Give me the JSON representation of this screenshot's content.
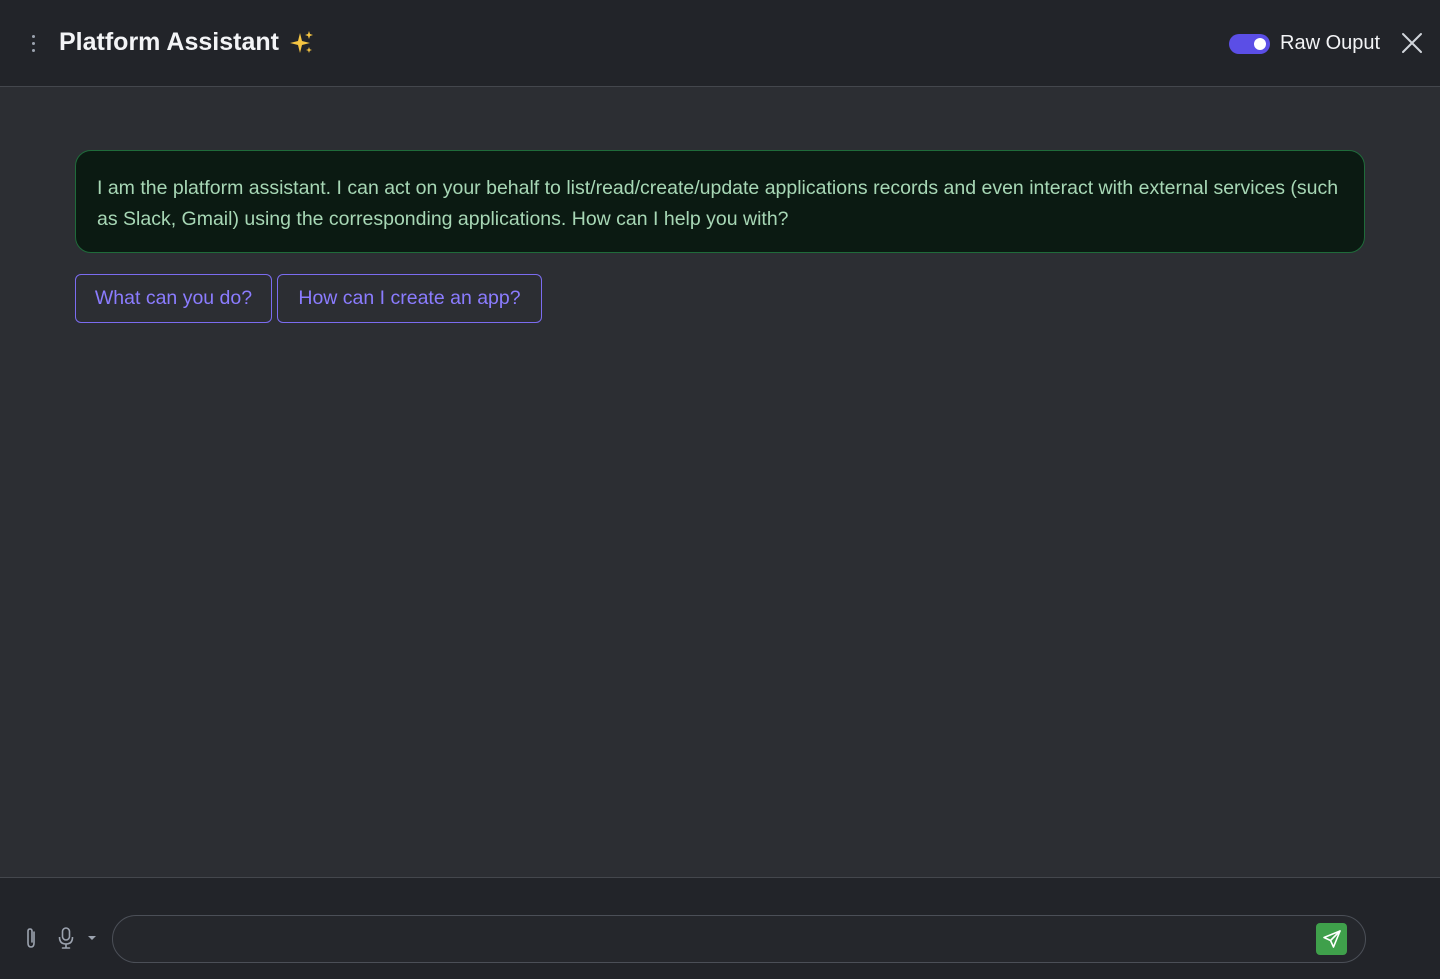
{
  "header": {
    "title": "Platform Assistant",
    "toggle_label": "Raw Ouput",
    "toggle_on": true
  },
  "message": {
    "text": "I am the platform assistant. I can act on your behalf to list/read/create/update applications records and even interact with external services (such as Slack, Gmail) using the corresponding applications. How can I help you with?"
  },
  "suggestions": [
    {
      "label": "What can you do?"
    },
    {
      "label": "How can I create an app?"
    }
  ],
  "composer": {
    "value": "",
    "placeholder": ""
  },
  "colors": {
    "accent": "#5b4ee6",
    "message_bg": "#0b1a12",
    "message_text": "#a7d7b5",
    "send_button": "#3fa04b"
  },
  "icons": {
    "menu": "kebab-menu-icon",
    "sparkle": "sparkles-icon",
    "close": "close-icon",
    "attach": "paperclip-icon",
    "mic": "microphone-icon",
    "caret": "caret-down-icon",
    "send": "send-icon"
  }
}
